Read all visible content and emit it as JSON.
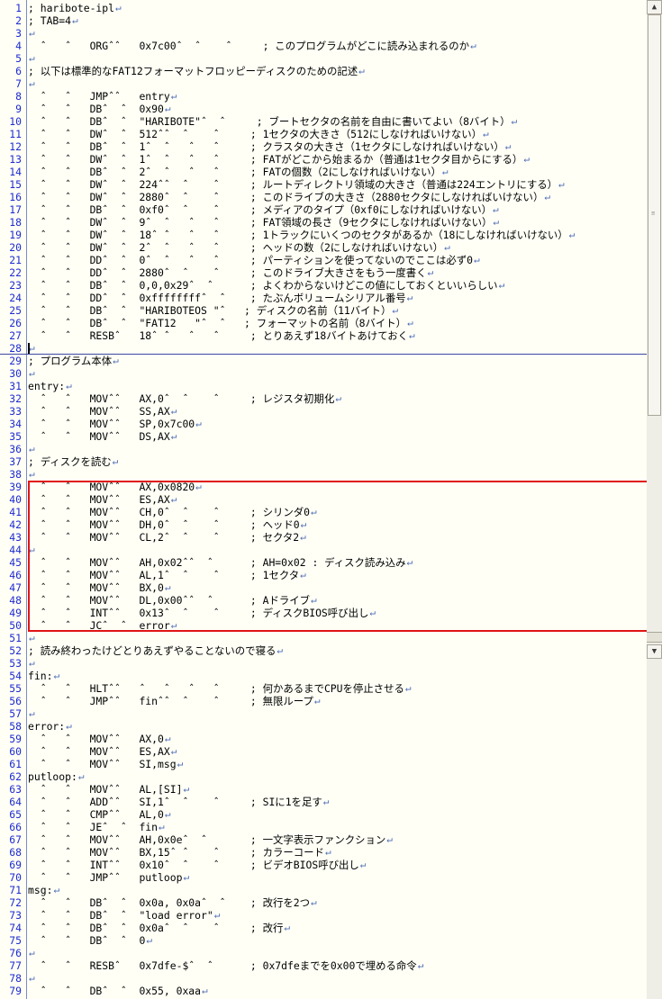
{
  "editor": {
    "eol_mark": "↵",
    "lines": [
      {
        "n": "1",
        "text": "; haribote-ipl"
      },
      {
        "n": "2",
        "text": "; TAB=4"
      },
      {
        "n": "3",
        "text": ""
      },
      {
        "n": "4",
        "text": "  ˆ   ˆ   ORGˆˆ   0x7c00ˆ  ˆ    ˆ     ; このプログラムがどこに読み込まれるのか"
      },
      {
        "n": "5",
        "text": ""
      },
      {
        "n": "6",
        "text": "; 以下は標準的なFAT12フォーマットフロッピーディスクのための記述"
      },
      {
        "n": "7",
        "text": ""
      },
      {
        "n": "8",
        "text": "  ˆ   ˆ   JMPˆˆ   entry"
      },
      {
        "n": "9",
        "text": "  ˆ   ˆ   DBˆ  ˆ  0x90"
      },
      {
        "n": "10",
        "text": "  ˆ   ˆ   DBˆ  ˆ  \"HARIBOTE\"ˆ  ˆ     ; ブートセクタの名前を自由に書いてよい（8バイト）"
      },
      {
        "n": "11",
        "text": "  ˆ   ˆ   DWˆ  ˆ  512ˆˆ  ˆ    ˆ     ; 1セクタの大きさ（512にしなければいけない）"
      },
      {
        "n": "12",
        "text": "  ˆ   ˆ   DBˆ  ˆ  1ˆ  ˆ   ˆ   ˆ     ; クラスタの大きさ（1セクタにしなければいけない）"
      },
      {
        "n": "13",
        "text": "  ˆ   ˆ   DWˆ  ˆ  1ˆ  ˆ   ˆ   ˆ     ; FATがどこから始まるか（普通は1セクタ目からにする）"
      },
      {
        "n": "14",
        "text": "  ˆ   ˆ   DBˆ  ˆ  2ˆ  ˆ   ˆ   ˆ     ; FATの個数（2にしなければいけない）"
      },
      {
        "n": "15",
        "text": "  ˆ   ˆ   DWˆ  ˆ  224ˆˆ  ˆ    ˆ     ; ルートディレクトリ領域の大きさ（普通は224エントリにする）"
      },
      {
        "n": "16",
        "text": "  ˆ   ˆ   DWˆ  ˆ  2880ˆ  ˆ    ˆ     ; このドライブの大きさ（2880セクタにしなければいけない）"
      },
      {
        "n": "17",
        "text": "  ˆ   ˆ   DBˆ  ˆ  0xf0ˆ  ˆ    ˆ     ; メディアのタイプ（0xf0にしなければいけない）"
      },
      {
        "n": "18",
        "text": "  ˆ   ˆ   DWˆ  ˆ  9ˆ  ˆ   ˆ   ˆ     ; FAT領域の長さ（9セクタにしなければいけない）"
      },
      {
        "n": "19",
        "text": "  ˆ   ˆ   DWˆ  ˆ  18ˆ ˆ   ˆ   ˆ     ; 1トラックにいくつのセクタがあるか（18にしなければいけない）"
      },
      {
        "n": "20",
        "text": "  ˆ   ˆ   DWˆ  ˆ  2ˆ  ˆ   ˆ   ˆ     ; ヘッドの数（2にしなければいけない）"
      },
      {
        "n": "21",
        "text": "  ˆ   ˆ   DDˆ  ˆ  0ˆ  ˆ   ˆ   ˆ     ; パーティションを使ってないのでここは必ず0"
      },
      {
        "n": "22",
        "text": "  ˆ   ˆ   DDˆ  ˆ  2880ˆ  ˆ    ˆ     ; このドライブ大きさをもう一度書く"
      },
      {
        "n": "23",
        "text": "  ˆ   ˆ   DBˆ  ˆ  0,0,0x29ˆ  ˆ      ; よくわからないけどこの値にしておくといいらしい"
      },
      {
        "n": "24",
        "text": "  ˆ   ˆ   DDˆ  ˆ  0xffffffffˆ  ˆ    ; たぶんボリュームシリアル番号"
      },
      {
        "n": "25",
        "text": "  ˆ   ˆ   DBˆ  ˆ  \"HARIBOTEOS \"ˆ   ; ディスクの名前（11バイト）"
      },
      {
        "n": "26",
        "text": "  ˆ   ˆ   DBˆ  ˆ  \"FAT12   \"ˆ  ˆ   ; フォーマットの名前（8バイト）"
      },
      {
        "n": "27",
        "text": "  ˆ   ˆ   RESBˆ   18ˆ ˆ   ˆ   ˆ     ; とりあえず18バイトあけておく"
      },
      {
        "n": "28",
        "text": "",
        "current": true
      },
      {
        "n": "29",
        "text": "; プログラム本体"
      },
      {
        "n": "30",
        "text": ""
      },
      {
        "n": "31",
        "text": "entry:"
      },
      {
        "n": "32",
        "text": "  ˆ   ˆ   MOVˆˆ   AX,0ˆ  ˆ    ˆ     ; レジスタ初期化"
      },
      {
        "n": "33",
        "text": "  ˆ   ˆ   MOVˆˆ   SS,AX"
      },
      {
        "n": "34",
        "text": "  ˆ   ˆ   MOVˆˆ   SP,0x7c00"
      },
      {
        "n": "35",
        "text": "  ˆ   ˆ   MOVˆˆ   DS,AX"
      },
      {
        "n": "36",
        "text": ""
      },
      {
        "n": "37",
        "text": "; ディスクを読む"
      },
      {
        "n": "38",
        "text": ""
      },
      {
        "n": "39",
        "text": "  ˆ   ˆ   MOVˆˆ   AX,0x0820"
      },
      {
        "n": "40",
        "text": "  ˆ   ˆ   MOVˆˆ   ES,AX"
      },
      {
        "n": "41",
        "text": "  ˆ   ˆ   MOVˆˆ   CH,0ˆ  ˆ    ˆ     ; シリンダ0"
      },
      {
        "n": "42",
        "text": "  ˆ   ˆ   MOVˆˆ   DH,0ˆ  ˆ    ˆ     ; ヘッド0"
      },
      {
        "n": "43",
        "text": "  ˆ   ˆ   MOVˆˆ   CL,2ˆ  ˆ    ˆ     ; セクタ2"
      },
      {
        "n": "44",
        "text": ""
      },
      {
        "n": "45",
        "text": "  ˆ   ˆ   MOVˆˆ   AH,0x02ˆˆ  ˆ      ; AH=0x02 : ディスク読み込み"
      },
      {
        "n": "46",
        "text": "  ˆ   ˆ   MOVˆˆ   AL,1ˆ  ˆ    ˆ     ; 1セクタ"
      },
      {
        "n": "47",
        "text": "  ˆ   ˆ   MOVˆˆ   BX,0"
      },
      {
        "n": "48",
        "text": "  ˆ   ˆ   MOVˆˆ   DL,0x00ˆˆ  ˆ      ; Aドライブ"
      },
      {
        "n": "49",
        "text": "  ˆ   ˆ   INTˆˆ   0x13ˆ  ˆ    ˆ     ; ディスクBIOS呼び出し"
      },
      {
        "n": "50",
        "text": "  ˆ   ˆ   JCˆ  ˆ  error"
      },
      {
        "n": "51",
        "text": ""
      },
      {
        "n": "52",
        "text": "; 読み終わったけどとりあえずやることないので寝る"
      },
      {
        "n": "53",
        "text": ""
      },
      {
        "n": "54",
        "text": "fin:"
      },
      {
        "n": "55",
        "text": "  ˆ   ˆ   HLTˆˆ   ˆ   ˆ   ˆ   ˆ     ; 何かあるまでCPUを停止させる"
      },
      {
        "n": "56",
        "text": "  ˆ   ˆ   JMPˆˆ   finˆˆ  ˆ    ˆ     ; 無限ループ"
      },
      {
        "n": "57",
        "text": ""
      },
      {
        "n": "58",
        "text": "error:"
      },
      {
        "n": "59",
        "text": "  ˆ   ˆ   MOVˆˆ   AX,0"
      },
      {
        "n": "60",
        "text": "  ˆ   ˆ   MOVˆˆ   ES,AX"
      },
      {
        "n": "61",
        "text": "  ˆ   ˆ   MOVˆˆ   SI,msg"
      },
      {
        "n": "62",
        "text": "putloop:"
      },
      {
        "n": "63",
        "text": "  ˆ   ˆ   MOVˆˆ   AL,[SI]"
      },
      {
        "n": "64",
        "text": "  ˆ   ˆ   ADDˆˆ   SI,1ˆ  ˆ    ˆ     ; SIに1を足す"
      },
      {
        "n": "65",
        "text": "  ˆ   ˆ   CMPˆˆ   AL,0"
      },
      {
        "n": "66",
        "text": "  ˆ   ˆ   JEˆ  ˆ  fin"
      },
      {
        "n": "67",
        "text": "  ˆ   ˆ   MOVˆˆ   AH,0x0eˆ  ˆ       ; 一文字表示ファンクション"
      },
      {
        "n": "68",
        "text": "  ˆ   ˆ   MOVˆˆ   BX,15ˆ ˆ    ˆ     ; カラーコード"
      },
      {
        "n": "69",
        "text": "  ˆ   ˆ   INTˆˆ   0x10ˆ  ˆ    ˆ     ; ビデオBIOS呼び出し"
      },
      {
        "n": "70",
        "text": "  ˆ   ˆ   JMPˆˆ   putloop"
      },
      {
        "n": "71",
        "text": "msg:"
      },
      {
        "n": "72",
        "text": "  ˆ   ˆ   DBˆ  ˆ  0x0a, 0x0aˆ  ˆ    ; 改行を2つ"
      },
      {
        "n": "73",
        "text": "  ˆ   ˆ   DBˆ  ˆ  \"load error\""
      },
      {
        "n": "74",
        "text": "  ˆ   ˆ   DBˆ  ˆ  0x0aˆ  ˆ    ˆ     ; 改行"
      },
      {
        "n": "75",
        "text": "  ˆ   ˆ   DBˆ  ˆ  0"
      },
      {
        "n": "76",
        "text": ""
      },
      {
        "n": "77",
        "text": "  ˆ   ˆ   RESBˆ   0x7dfe-$ˆ  ˆ      ; 0x7dfeまでを0x00で埋める命令"
      },
      {
        "n": "78",
        "text": ""
      },
      {
        "n": "79",
        "text": "  ˆ   ˆ   DBˆ  ˆ  0x55, 0xaa"
      }
    ]
  },
  "highlight": {
    "from_line": "39",
    "to_line": "50",
    "color": "#e01515"
  },
  "scrollbar": {
    "up_arrow": "▲",
    "down_arrow": "▼",
    "grip": "≡",
    "up_icon": "scroll-up-icon",
    "down_icon": "scroll-down-icon"
  },
  "colors": {
    "background": "#fffff6",
    "line_numbers": "#1d2bd0",
    "eol_mark": "#4d6cb5",
    "current_line_rule": "#3c46a0"
  }
}
